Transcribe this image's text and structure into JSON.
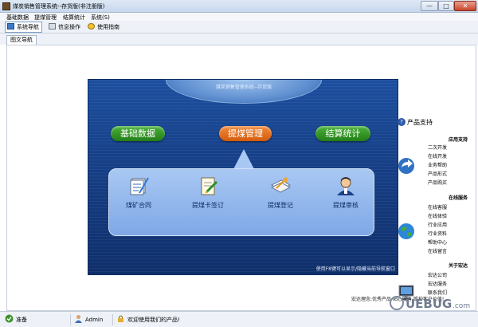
{
  "window": {
    "title": "煤炭销售管理系统--存货版(非注册版)",
    "min": "—",
    "max": "□",
    "close": "✕"
  },
  "menu": [
    "基础数据",
    "提煤管理",
    "结算统计",
    "系统(S)"
  ],
  "toolbar": [
    {
      "label": "系统导航",
      "icon": "nav-icon"
    },
    {
      "label": "信息操作",
      "icon": "info-icon"
    },
    {
      "label": "使用指南",
      "icon": "help-icon"
    }
  ],
  "doc_tab": "图文导航",
  "panel": {
    "title": "煤炭销售管理系统--存货版",
    "pills": [
      "基础数据",
      "提煤管理",
      "结算统计"
    ],
    "sub_items": [
      {
        "label": "煤矿合同",
        "icon": "contract-icon"
      },
      {
        "label": "提煤卡签订",
        "icon": "card-sign-icon"
      },
      {
        "label": "提煤登记",
        "icon": "register-icon"
      },
      {
        "label": "提煤审核",
        "icon": "audit-icon"
      }
    ],
    "hint": "使用F8键可以显示/隐藏当前导航窗口"
  },
  "support": {
    "title": "产品支持",
    "groups": [
      {
        "heading": "应用支持",
        "icon": "arrow-icon",
        "links": [
          "二次开发",
          "在线开发",
          "业务帮助",
          "产品形式",
          "产品购买"
        ]
      },
      {
        "heading": "在线服务",
        "icon": "globe-icon",
        "links": [
          "在线客服",
          "在线体验",
          "行业应用",
          "行业资料",
          "帮助中心",
          "在线留言"
        ]
      },
      {
        "heading": "关于宏达",
        "icon": "monitor-icon",
        "links": [
          "宏达公司",
          "宏达服务",
          "联系我们"
        ]
      }
    ]
  },
  "slogan": "宏达理念:优秀产品 贴心服务 维护客户价值!",
  "status": {
    "ready": "准备",
    "user": "Admin",
    "welcome": "欢迎使用我们的产品!"
  },
  "colors": {
    "panel_blue": "#163f86",
    "pill_green": "#2f9424",
    "pill_orange": "#e06a18",
    "sub_panel": "#9fc0ef"
  }
}
